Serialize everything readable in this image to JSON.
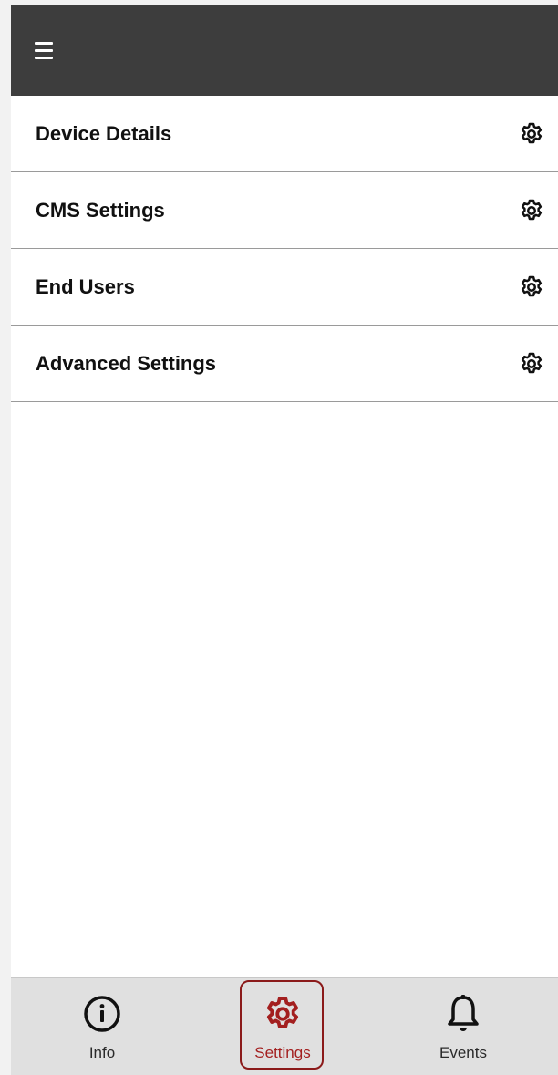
{
  "header": {
    "menu_icon": "hamburger-menu-icon"
  },
  "settings_list": [
    {
      "label": "Device Details",
      "icon": "gear-icon"
    },
    {
      "label": "CMS Settings",
      "icon": "gear-icon"
    },
    {
      "label": "End Users",
      "icon": "gear-icon"
    },
    {
      "label": "Advanced Settings",
      "icon": "gear-icon"
    }
  ],
  "bottom_nav": {
    "items": [
      {
        "label": "Info",
        "icon": "info-circle-icon"
      },
      {
        "label": "Settings",
        "icon": "gear-icon",
        "active": true
      },
      {
        "label": "Events",
        "icon": "bell-icon"
      }
    ]
  },
  "colors": {
    "topbar": "#3d3d3d",
    "active_accent": "#a31f1f",
    "bottom_nav_bg": "#e0e0e0"
  }
}
